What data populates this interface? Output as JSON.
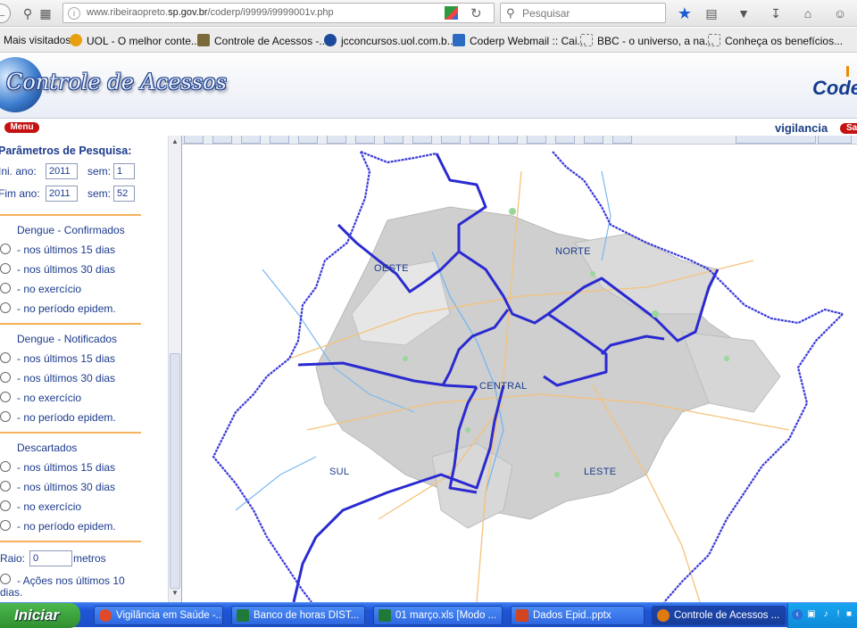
{
  "browser": {
    "url_prefix": "www.ribeiraopreto.",
    "url_domain": "sp.gov.br",
    "url_path": "/coderp/i9999/i9999001v.php",
    "search_placeholder": "Pesquisar"
  },
  "bookmarks": [
    {
      "label": "Mais visitados",
      "icon": "gear-icon",
      "color": "#7b7b7b"
    },
    {
      "label": "UOL - O melhor conte...",
      "icon": "uol-icon",
      "color": "#e8a010"
    },
    {
      "label": "Controle de Acessos -...",
      "icon": "controle-icon",
      "color": "#7a6a3a"
    },
    {
      "label": "jcconcursos.uol.com.b...",
      "icon": "jc-icon",
      "color": "#1c4b9b"
    },
    {
      "label": "Coderp Webmail :: Cai...",
      "icon": "coderp-icon",
      "color": "#2b6bc2"
    },
    {
      "label": "BBC - o universo, a na...",
      "icon": "page-icon",
      "color": "#ffffff"
    },
    {
      "label": "Conheça os benefícios...",
      "icon": "page-icon",
      "color": "#ffffff"
    }
  ],
  "site": {
    "title": "Controle de Acessos",
    "logo_text": "Coder",
    "menu_label": "Menu",
    "user": "vigilancia",
    "exit_label": "Sa"
  },
  "panel": {
    "params_title": "Parâmetros de Pesquisa:",
    "ini_label": "Ini. ano:",
    "ini_year": "2011",
    "ini_sem_label": "sem:",
    "ini_sem": "1",
    "fim_label": "Fim ano:",
    "fim_year": "2011",
    "fim_sem_label": "sem:",
    "fim_sem": "52",
    "groups": [
      {
        "title": "Dengue - Confirmados",
        "options": [
          "- nos últimos 15 dias",
          "- nos últimos 30 dias",
          "- no exercício",
          "- no período epidem."
        ]
      },
      {
        "title": "Dengue - Notificados",
        "options": [
          "- nos últimos 15 dias",
          "- nos últimos 30 dias",
          "- no exercício",
          "- no período epidem."
        ]
      },
      {
        "title": "Descartados",
        "options": [
          "- nos últimos 15 dias",
          "- nos últimos 30 dias",
          "- no exercício",
          "- no período epidem."
        ]
      }
    ],
    "raio_label": "Raio:",
    "raio_value": "0",
    "raio_unit": "metros",
    "acoes_label_1": "- Ações nos últimos 10",
    "acoes_label_2": "dias."
  },
  "map": {
    "regions": [
      "OESTE",
      "NORTE",
      "CENTRAL",
      "SUL",
      "LESTE"
    ],
    "boundary_color": "#2020c8",
    "urban_color": "#c9c9c9",
    "road_color": "#f5c27a",
    "river_color": "#7ab8f0"
  },
  "taskbar": {
    "start_label": "Iniciar",
    "tasks": [
      {
        "label": "Vigilância em Saúde -...",
        "color": "#e04a2a"
      },
      {
        "label": "Banco de horas DIST...",
        "color": "#1f7a3a"
      },
      {
        "label": "01 março.xls  [Modo ...",
        "color": "#1f7a3a"
      },
      {
        "label": "Dados Epid..pptx",
        "color": "#d2451e"
      },
      {
        "label": "Controle de Acessos ...",
        "color": "#e07a10"
      }
    ]
  }
}
